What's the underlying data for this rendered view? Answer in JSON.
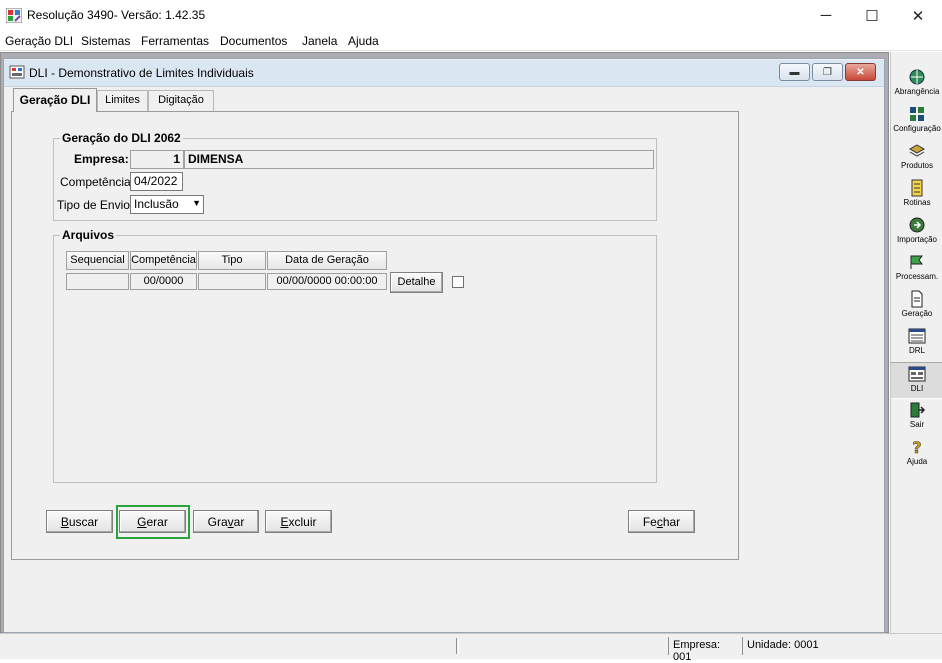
{
  "app": {
    "title": "Resolução 3490- Versão: 1.42.35",
    "window_controls": {
      "minimize": "─",
      "maximize": "☐",
      "close": "✕"
    }
  },
  "menu": [
    "Geração DLI",
    "Sistemas",
    "Ferramentas",
    "Documentos",
    "Janela",
    "Ajuda"
  ],
  "child_window": {
    "title": "DLI -  Demonstrativo de Limites Individuais",
    "tabs": [
      "Geração DLI",
      "Limites",
      "Digitação"
    ],
    "active_tab": "Geração DLI"
  },
  "geracao": {
    "group_title": "Geração do DLI 2062",
    "empresa_label": "Empresa:",
    "empresa_code": "1",
    "empresa_name": "DIMENSA",
    "competencia_label": "Competência:",
    "competencia_value": "04/2022",
    "tipo_envio_label": "Tipo de Envio:",
    "tipo_envio_value": "Inclusão"
  },
  "arquivos": {
    "group_title": "Arquivos",
    "columns": [
      "Sequencial",
      "Competência",
      "Tipo",
      "Data de Geração"
    ],
    "row": {
      "sequencial": "",
      "competencia": "00/0000",
      "tipo": "",
      "data_geracao": "00/00/0000 00:00:00"
    },
    "detalhe_label": "Detalhe",
    "checkbox_checked": false
  },
  "buttons": {
    "buscar_u": "B",
    "buscar_rest": "uscar",
    "gerar_u": "G",
    "gerar_rest": "erar",
    "gravar_a": "Gra",
    "gravar_u": "v",
    "gravar_b": "ar",
    "excluir_u": "E",
    "excluir_rest": "xcluir",
    "fechar_a": "Fe",
    "fechar_u": "c",
    "fechar_b": "har"
  },
  "highlight_color": "#2aa33b",
  "toolbar": [
    {
      "label": "Abrangência",
      "icon": "globe-icon"
    },
    {
      "label": "Configuração",
      "icon": "config-icon"
    },
    {
      "label": "Produtos",
      "icon": "products-icon"
    },
    {
      "label": "Rotinas",
      "icon": "routines-icon"
    },
    {
      "label": "Importação",
      "icon": "import-icon"
    },
    {
      "label": "Processam.",
      "icon": "process-icon"
    },
    {
      "label": "Geração",
      "icon": "document-icon"
    },
    {
      "label": "DRL",
      "icon": "drl-icon"
    },
    {
      "label": "DLI",
      "icon": "dli-icon"
    },
    {
      "label": "Sair",
      "icon": "exit-icon"
    },
    {
      "label": "Ajuda",
      "icon": "help-icon"
    }
  ],
  "status": {
    "empresa": "Empresa: 001",
    "unidade": "Unidade: 0001"
  }
}
